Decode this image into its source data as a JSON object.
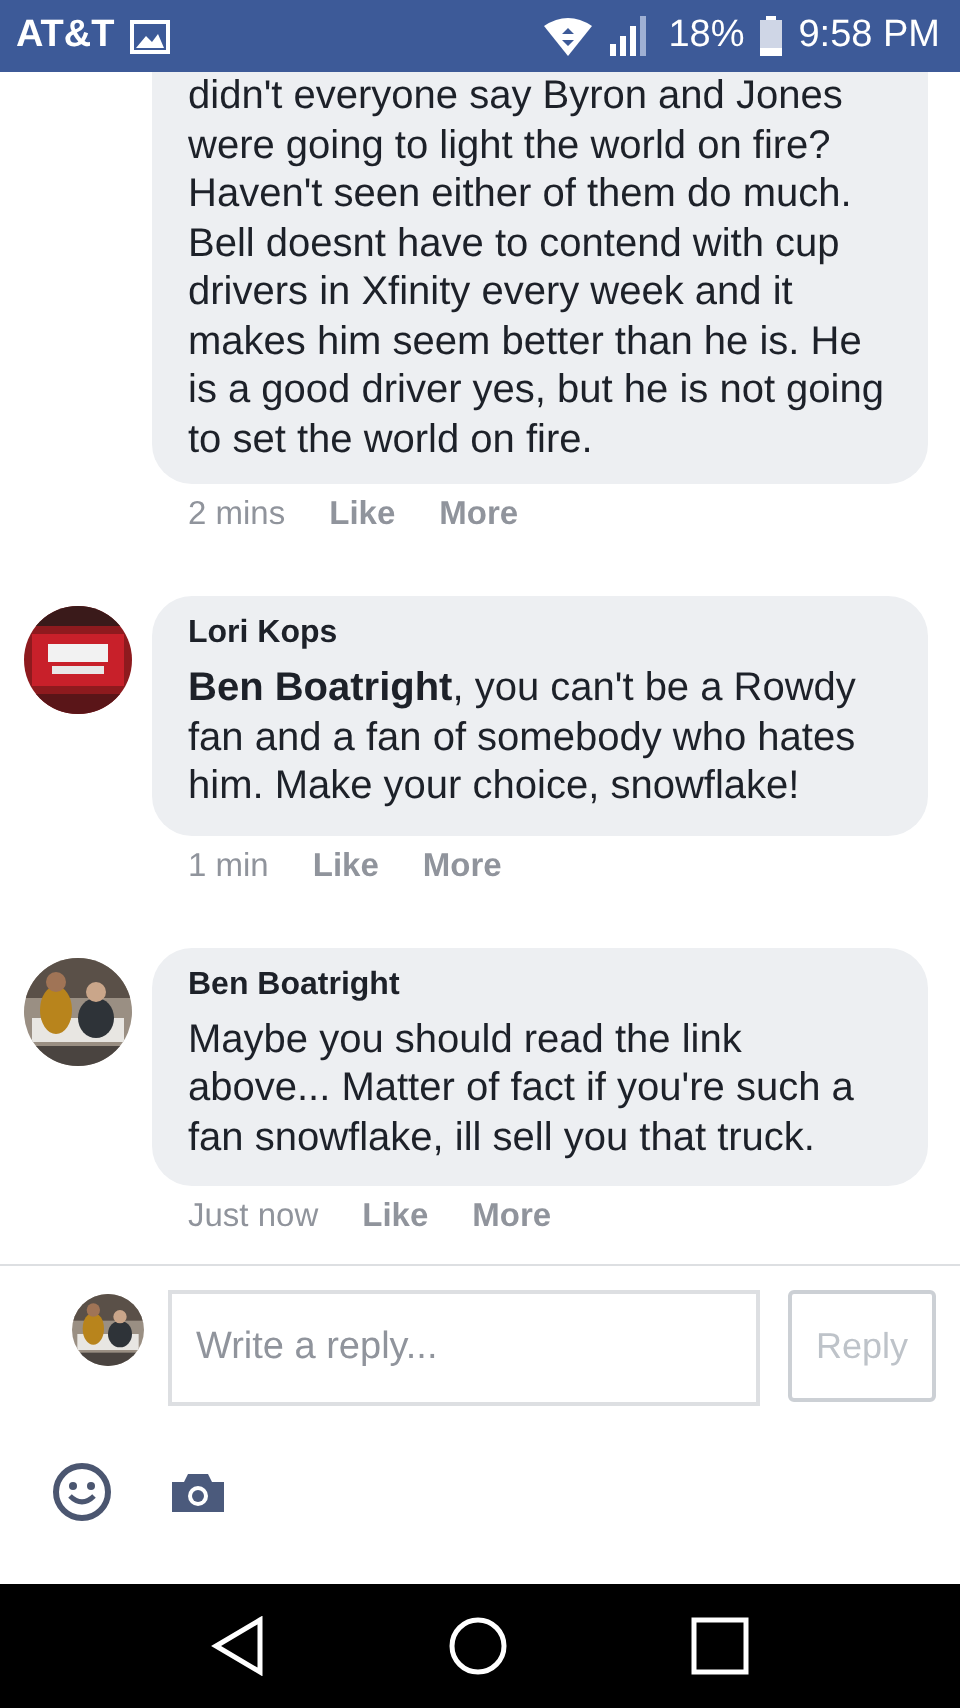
{
  "status_bar": {
    "carrier": "AT&T",
    "battery": "18%",
    "time": "9:58 PM"
  },
  "comments": [
    {
      "text": "didn't everyone say Byron and Jones were going to light the world on fire? Haven't seen either of them do much. Bell doesnt have to contend with cup drivers in Xfinity every week and it makes him seem better than he is. He is a good driver yes, but he is not going to set the world on fire.",
      "time": "2 mins",
      "actions": [
        "Like",
        "More"
      ]
    },
    {
      "author": "Lori Kops",
      "text": "**Ben Boatright**, you can't be a Rowdy fan and a fan of somebody who hates him. Make your choice, snowflake!",
      "time": "1 min",
      "actions": [
        "Like",
        "More"
      ]
    },
    {
      "author": "Ben Boatright",
      "text": "Maybe you should read the link above... Matter of fact if you're such a fan snowflake, ill sell you that truck.",
      "time": "Just now",
      "actions": [
        "Like",
        "More"
      ]
    }
  ],
  "composer": {
    "placeholder": "Write a reply...",
    "button": "Reply"
  }
}
